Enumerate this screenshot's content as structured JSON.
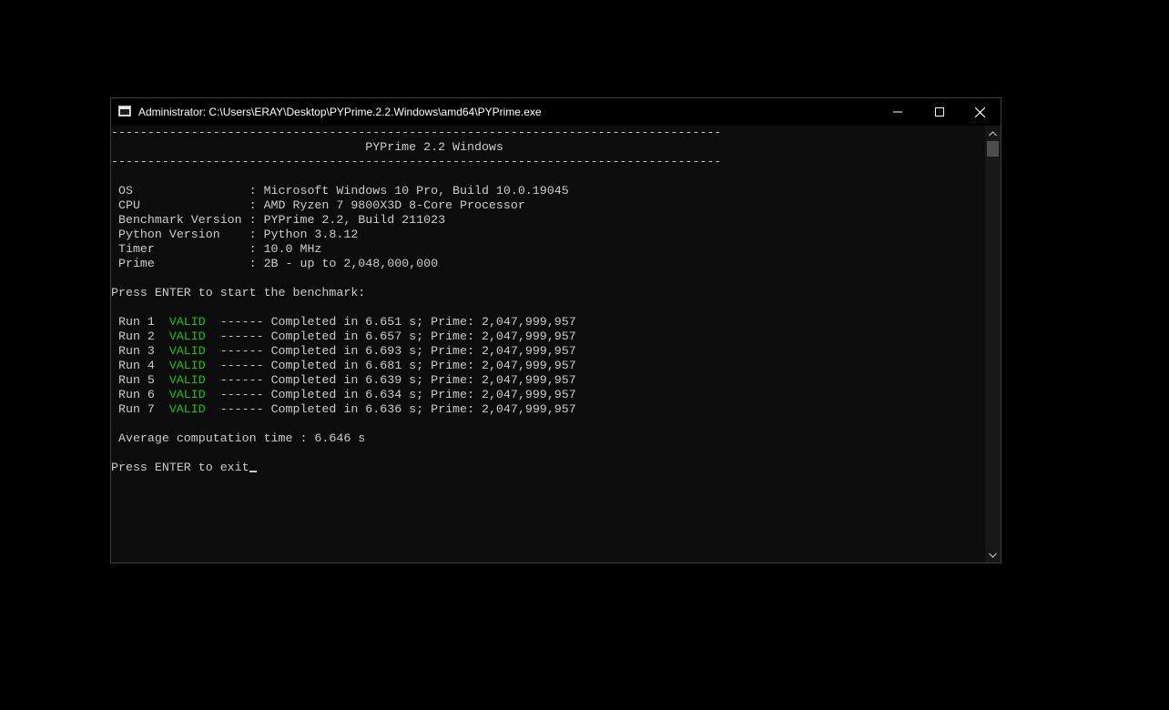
{
  "window": {
    "title": "Administrator:  C:\\Users\\ERAY\\Desktop\\PYPrime.2.2.Windows\\amd64\\PYPrime.exe",
    "controls": {
      "minimize_icon": "minimize-icon",
      "maximize_icon": "maximize-icon",
      "close_icon": "close-icon"
    }
  },
  "console": {
    "separator": "------------------------------------------------------------------------------------",
    "header": "                                   PYPrime 2.2 Windows",
    "info": [
      {
        "label": " OS                ",
        "value": ": Microsoft Windows 10 Pro, Build 10.0.19045"
      },
      {
        "label": " CPU               ",
        "value": ": AMD Ryzen 7 9800X3D 8-Core Processor"
      },
      {
        "label": " Benchmark Version ",
        "value": ": PYPrime 2.2, Build 211023"
      },
      {
        "label": " Python Version    ",
        "value": ": Python 3.8.12"
      },
      {
        "label": " Timer             ",
        "value": ": 10.0 MHz"
      },
      {
        "label": " Prime             ",
        "value": ": 2B - up to 2,048,000,000"
      }
    ],
    "start_prompt": "Press ENTER to start the benchmark:",
    "runs": [
      {
        "run": " Run 1  ",
        "status": "VALID",
        "detail": "  ------ Completed in 6.651 s; Prime: 2,047,999,957"
      },
      {
        "run": " Run 2  ",
        "status": "VALID",
        "detail": "  ------ Completed in 6.657 s; Prime: 2,047,999,957"
      },
      {
        "run": " Run 3  ",
        "status": "VALID",
        "detail": "  ------ Completed in 6.693 s; Prime: 2,047,999,957"
      },
      {
        "run": " Run 4  ",
        "status": "VALID",
        "detail": "  ------ Completed in 6.681 s; Prime: 2,047,999,957"
      },
      {
        "run": " Run 5  ",
        "status": "VALID",
        "detail": "  ------ Completed in 6.639 s; Prime: 2,047,999,957"
      },
      {
        "run": " Run 6  ",
        "status": "VALID",
        "detail": "  ------ Completed in 6.634 s; Prime: 2,047,999,957"
      },
      {
        "run": " Run 7  ",
        "status": "VALID",
        "detail": "  ------ Completed in 6.636 s; Prime: 2,047,999,957"
      }
    ],
    "average": " Average computation time : 6.646 s",
    "exit_prompt": "Press ENTER to exit"
  },
  "colors": {
    "valid": "#16c60c",
    "text": "#cccccc",
    "background": "#0c0c0c"
  }
}
